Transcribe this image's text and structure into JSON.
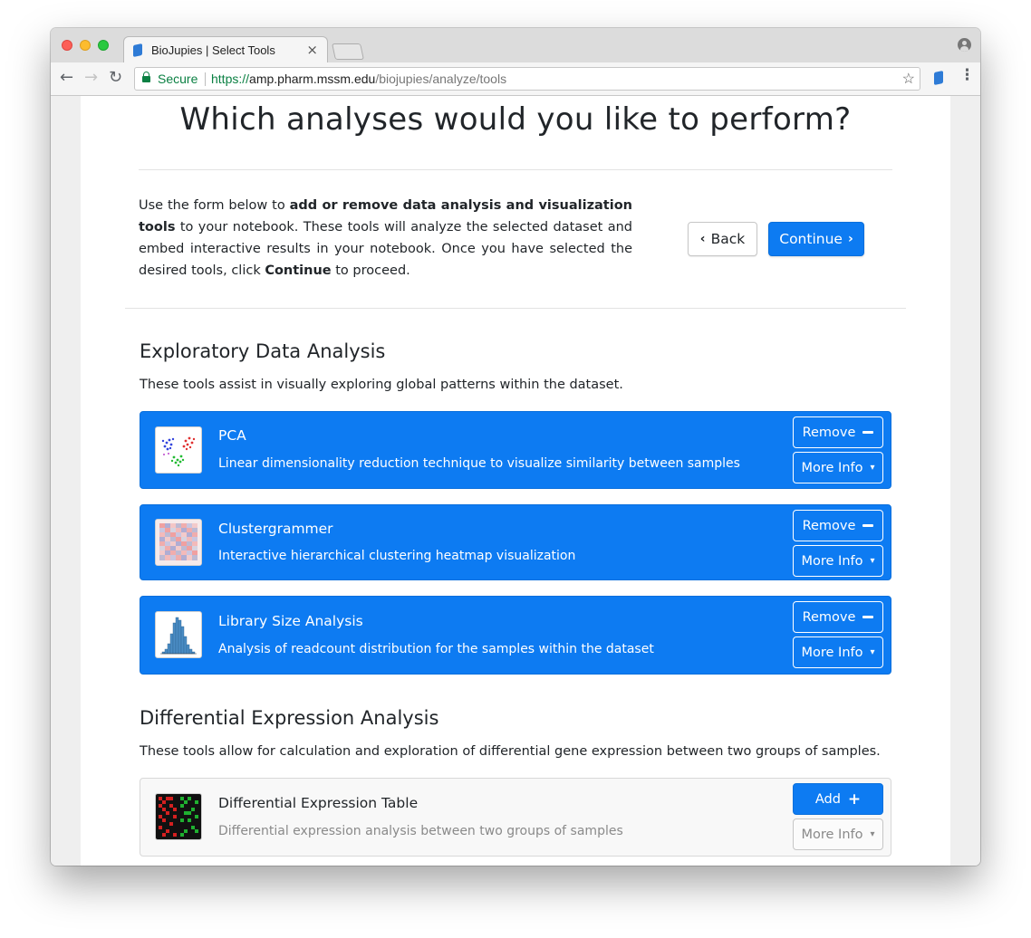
{
  "browser": {
    "tab_title": "BioJupies | Select Tools",
    "tab_close": "×",
    "secure_label": "Secure",
    "url_protocol": "https://",
    "url_host": "amp.pharm.mssm.edu",
    "url_path": "/biojupies/analyze/tools",
    "icons": [
      "back-arrow-icon",
      "forward-arrow-icon",
      "reload-icon",
      "lock-icon",
      "star-icon",
      "extension-icon",
      "menu-icon",
      "profile-icon"
    ]
  },
  "page": {
    "heading": "Which analyses would you like to perform?",
    "intro": {
      "part1": "Use the form below to ",
      "bold1": "add or remove data analysis and visualization tools",
      "part2": " to your notebook. These tools will analyze the selected dataset and embed interactive results in your notebook. Once you have selected the desired tools, click ",
      "bold2": "Continue",
      "part3": " to proceed."
    },
    "back_label": "Back",
    "continue_label": "Continue"
  },
  "sections": [
    {
      "title": "Exploratory Data Analysis",
      "description": "These tools assist in visually exploring global patterns within the dataset.",
      "tools": [
        {
          "name": "PCA",
          "description": "Linear dimensionality reduction technique to visualize similarity between samples",
          "selected": true,
          "action_label": "Remove",
          "more_label": "More Info"
        },
        {
          "name": "Clustergrammer",
          "description": "Interactive hierarchical clustering heatmap visualization",
          "selected": true,
          "action_label": "Remove",
          "more_label": "More Info"
        },
        {
          "name": "Library Size Analysis",
          "description": "Analysis of readcount distribution for the samples within the dataset",
          "selected": true,
          "action_label": "Remove",
          "more_label": "More Info"
        }
      ]
    },
    {
      "title": "Differential Expression Analysis",
      "description": "These tools allow for calculation and exploration of differential gene expression between two groups of samples.",
      "tools": [
        {
          "name": "Differential Expression Table",
          "description": "Differential expression analysis between two groups of samples",
          "selected": false,
          "action_label": "Add",
          "more_label": "More Info"
        }
      ]
    }
  ],
  "colors": {
    "primary": "#0d7bf2",
    "secure_green": "#0b8043",
    "text": "#212529"
  }
}
